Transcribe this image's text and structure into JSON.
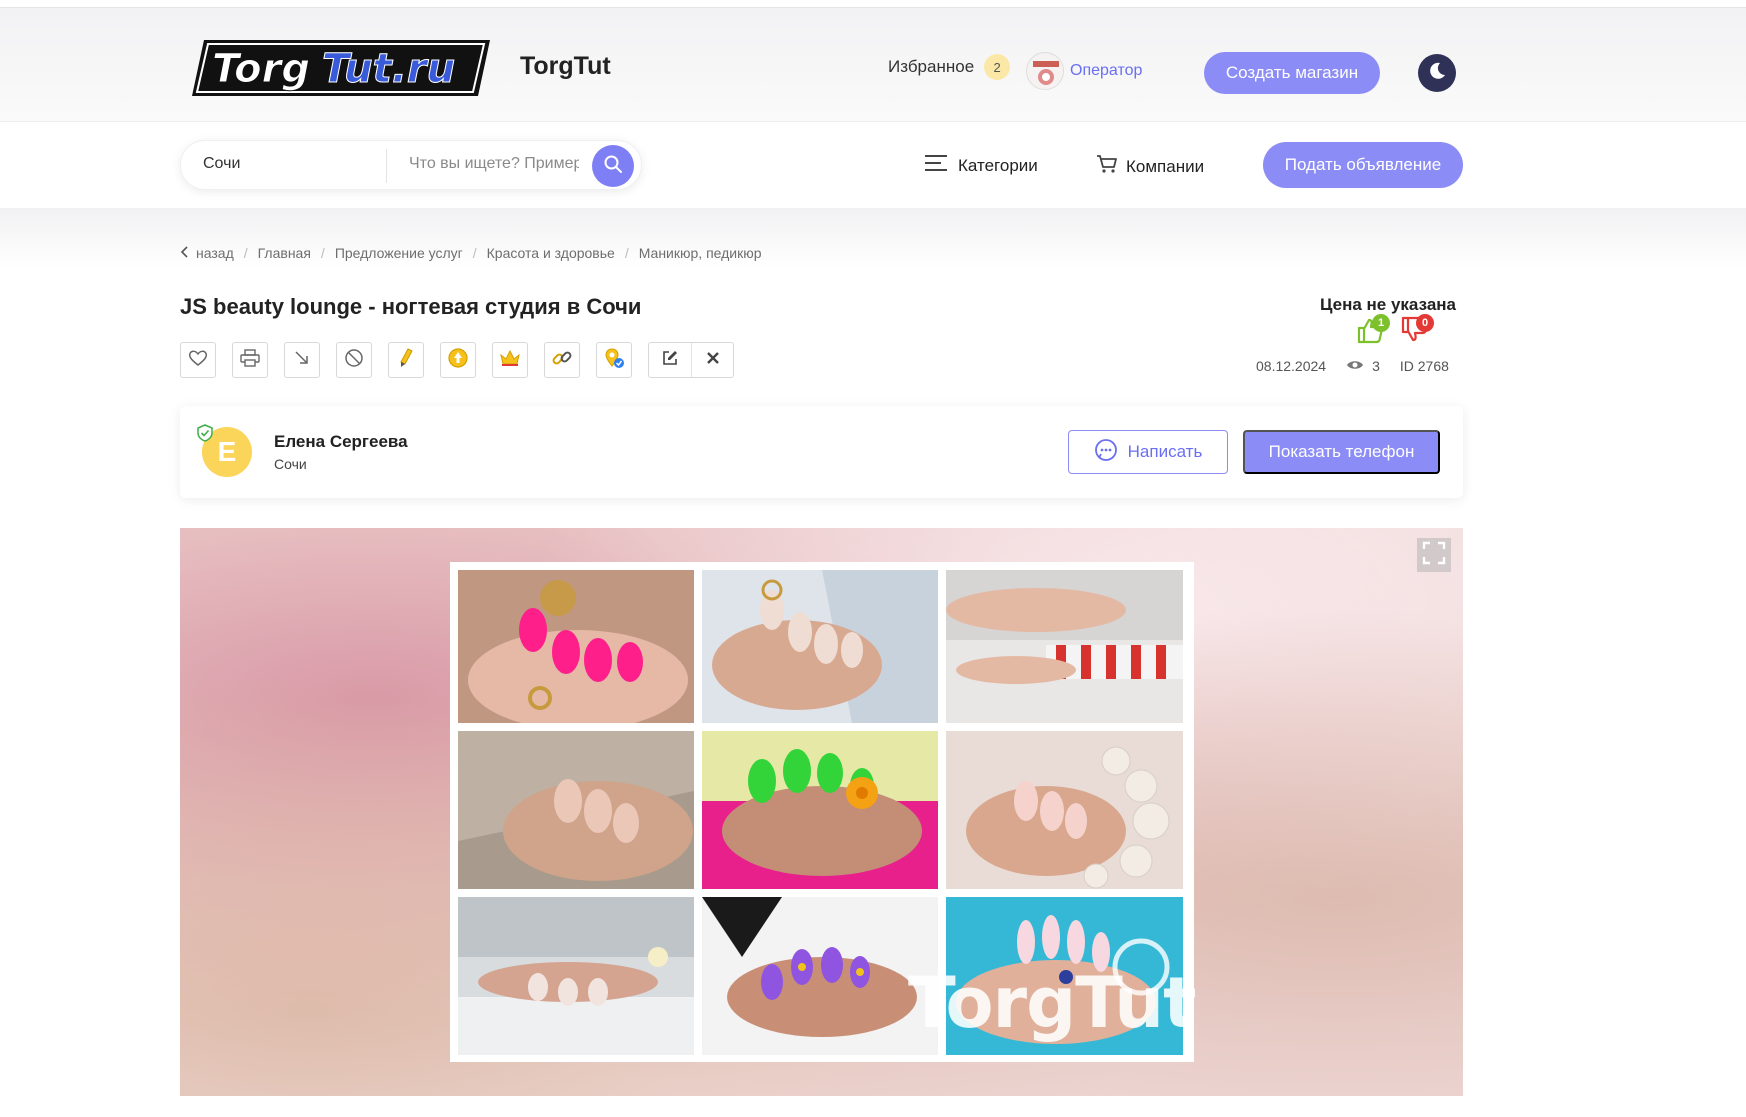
{
  "header": {
    "site_name": "TorgTut",
    "logo_text": "TorgTut.ru",
    "favorites_label": "Избранное",
    "favorites_count": "2",
    "operator_label": "Оператор",
    "create_shop_label": "Создать магазин"
  },
  "search": {
    "city_value": "Сочи",
    "query_placeholder": "Что вы ищете? Пример"
  },
  "nav": {
    "categories_label": "Категории",
    "companies_label": "Компании",
    "post_ad_label": "Подать объявление"
  },
  "breadcrumb": {
    "back": "назад",
    "items": [
      "Главная",
      "Предложение услуг",
      "Красота и здоровье",
      "Маникюр, педикюр"
    ]
  },
  "listing": {
    "title": "JS beauty lounge - ногтевая студия в Сочи",
    "price": "Цена не указана",
    "likes": "1",
    "dislikes": "0",
    "date": "08.12.2024",
    "views": "3",
    "id": "ID 2768"
  },
  "toolbar": {
    "icons": [
      "heart-icon",
      "print-icon",
      "arrow-down-right-icon",
      "block-icon",
      "pencil-icon",
      "up-coin-icon",
      "crown-icon",
      "link-icon",
      "location-check-icon",
      "edit-icon",
      "close-icon"
    ]
  },
  "seller": {
    "initial": "Е",
    "name": "Елена Сергеева",
    "city": "Сочи",
    "write_label": "Написать",
    "phone_label": "Показать телефон"
  },
  "gallery": {
    "watermark": "TorgTut"
  },
  "colors": {
    "accent": "#8b8cf6",
    "accent_text": "#6a6ff0",
    "like": "#7cc12c",
    "dislike": "#e53935",
    "avatar": "#fbd45a"
  }
}
